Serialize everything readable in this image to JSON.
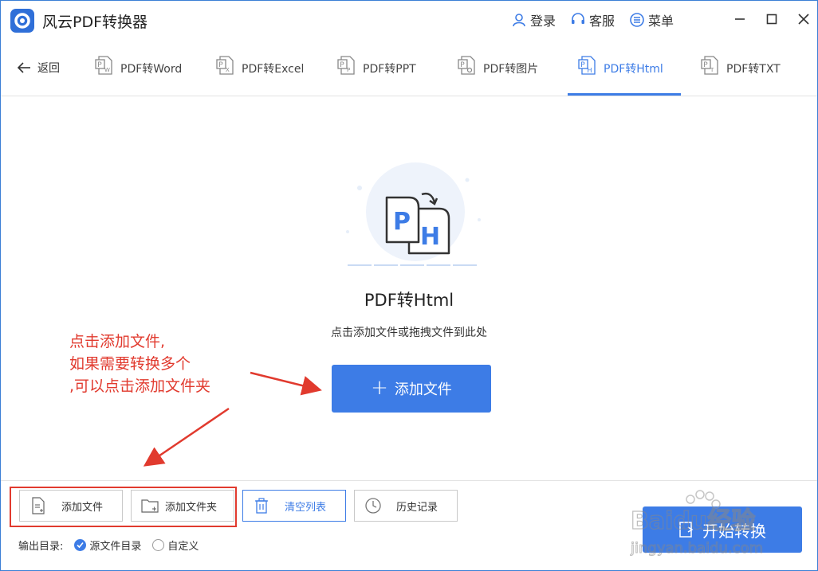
{
  "titlebar": {
    "app_title": "风云PDF转换器",
    "login_label": "登录",
    "service_label": "客服",
    "menu_label": "菜单"
  },
  "nav": {
    "back_label": "返回",
    "tabs": [
      {
        "label": "PDF转Word",
        "icon_letter": "W"
      },
      {
        "label": "PDF转Excel",
        "icon_letter": "X"
      },
      {
        "label": "PDF转PPT",
        "icon_letter": "P"
      },
      {
        "label": "PDF转图片",
        "icon_letter": "I"
      },
      {
        "label": "PDF转Html",
        "icon_letter": "H",
        "active": true
      },
      {
        "label": "PDF转TXT",
        "icon_letter": "T"
      }
    ]
  },
  "main": {
    "title": "PDF转Html",
    "subtitle": "点击添加文件或拖拽文件到此处",
    "add_button_label": "添加文件",
    "illus_letters": {
      "front": "P",
      "back": "H"
    }
  },
  "annotation": {
    "lines": [
      "点击添加文件,",
      "如果需要转换多个",
      ",可以点击添加文件夹"
    ],
    "color": "#e13a2e"
  },
  "toolbar": {
    "add_file_label": "添加文件",
    "add_folder_label": "添加文件夹",
    "clear_list_label": "清空列表",
    "history_label": "历史记录"
  },
  "output": {
    "label": "输出目录:",
    "options": [
      {
        "label": "源文件目录",
        "checked": true
      },
      {
        "label": "自定义",
        "checked": false
      }
    ]
  },
  "start_button_label": "开始转换",
  "watermark": {
    "brand": "Baidu经验",
    "url": "jingyan.baidu.com"
  },
  "colors": {
    "accent": "#3d7ce6",
    "annotation": "#e13a2e"
  }
}
